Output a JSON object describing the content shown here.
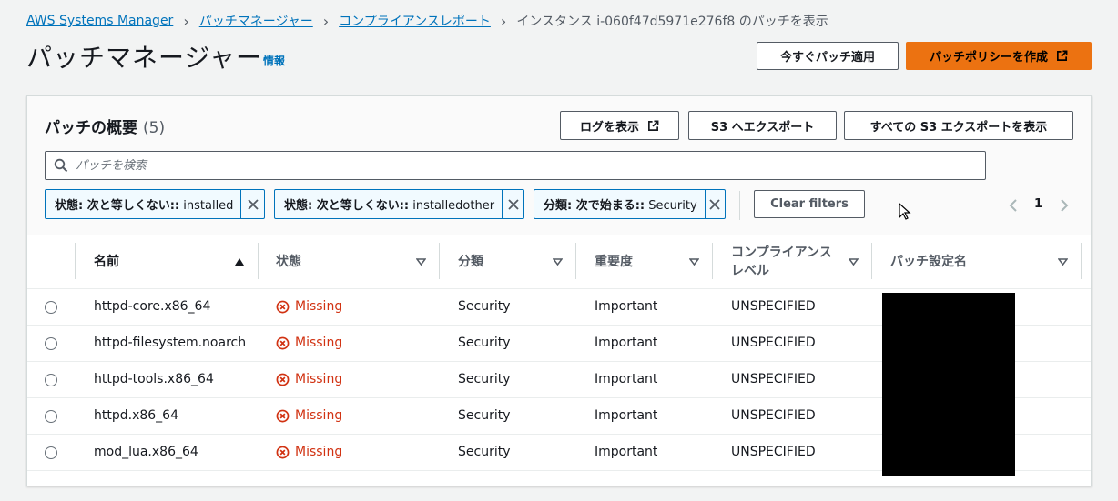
{
  "breadcrumb": {
    "items": [
      "AWS Systems Manager",
      "パッチマネージャー",
      "コンプライアンスレポート"
    ],
    "current": "インスタンス i-060f47d5971e276f8 のパッチを表示"
  },
  "header": {
    "title": "パッチマネージャー",
    "info": "情報",
    "patch_now_label": "今すぐパッチ適用",
    "create_policy_label": "パッチポリシーを作成"
  },
  "summary": {
    "title": "パッチの概要",
    "count": "(5)",
    "view_logs_label": "ログを表示",
    "export_s3_label": "S3 へエクスポート",
    "view_all_exports_label": "すべての S3 エクスポートを表示"
  },
  "search": {
    "placeholder": "パッチを検索"
  },
  "filters": [
    {
      "label": "状態: 次と等しくない::",
      "value": "installed"
    },
    {
      "label": "状態: 次と等しくない::",
      "value": "installedother"
    },
    {
      "label": "分類: 次で始まる::",
      "value": "Security"
    }
  ],
  "clear_filters_label": "Clear filters",
  "pagination": {
    "current_page": "1"
  },
  "table": {
    "columns": [
      "名前",
      "状態",
      "分類",
      "重要度",
      "コンプライアンス",
      "レベル",
      "パッチ設定名"
    ],
    "rows": [
      {
        "name": "httpd-core.x86_64",
        "status": "Missing",
        "classification": "Security",
        "severity": "Important",
        "compliance": "UNSPECIFIED"
      },
      {
        "name": "httpd-filesystem.noarch",
        "status": "Missing",
        "classification": "Security",
        "severity": "Important",
        "compliance": "UNSPECIFIED"
      },
      {
        "name": "httpd-tools.x86_64",
        "status": "Missing",
        "classification": "Security",
        "severity": "Important",
        "compliance": "UNSPECIFIED"
      },
      {
        "name": "httpd.x86_64",
        "status": "Missing",
        "classification": "Security",
        "severity": "Important",
        "compliance": "UNSPECIFIED"
      },
      {
        "name": "mod_lua.x86_64",
        "status": "Missing",
        "classification": "Security",
        "severity": "Important",
        "compliance": "UNSPECIFIED"
      }
    ]
  },
  "colors": {
    "link": "#0073bb",
    "primary": "#ec7211",
    "error": "#d13212"
  }
}
